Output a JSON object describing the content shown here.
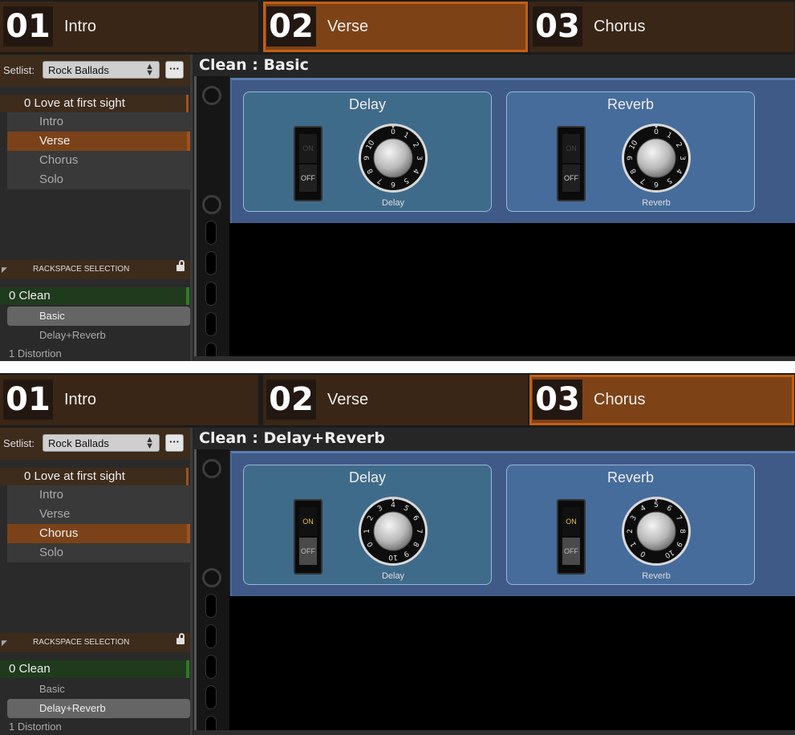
{
  "panels": [
    {
      "parts": [
        {
          "num": "01",
          "name": "Intro"
        },
        {
          "num": "02",
          "name": "Verse"
        },
        {
          "num": "03",
          "name": "Chorus"
        }
      ],
      "active_part": 1,
      "setlist_label": "Setlist:",
      "setlist_value": "Rock Ballads",
      "more_label": "···",
      "song": "0  Love at first sight",
      "song_parts": [
        "Intro",
        "Verse",
        "Chorus",
        "Solo"
      ],
      "active_song_part": 1,
      "rackspace_header": "RACKSPACE SELECTION",
      "rackspace": "0  Clean",
      "variations": [
        "Basic",
        "Delay+Reverb"
      ],
      "active_variation": 0,
      "rackspace_next": "1  Distortion",
      "title": "Clean : Basic",
      "delay": {
        "title": "Delay",
        "switch_on": "ON",
        "switch_off": "OFF",
        "switch_state": "off",
        "knob_label": "Delay",
        "knob_value": 0,
        "knob_ticks": [
          "0",
          "1",
          "2",
          "3",
          "4",
          "5",
          "6",
          "7",
          "8",
          "9",
          "10"
        ]
      },
      "reverb": {
        "title": "Reverb",
        "switch_on": "ON",
        "switch_off": "OFF",
        "switch_state": "off",
        "knob_label": "Reverb",
        "knob_value": 0,
        "knob_ticks": [
          "0",
          "1",
          "2",
          "3",
          "4",
          "5",
          "6",
          "7",
          "8",
          "9",
          "10"
        ]
      }
    },
    {
      "parts": [
        {
          "num": "01",
          "name": "Intro"
        },
        {
          "num": "02",
          "name": "Verse"
        },
        {
          "num": "03",
          "name": "Chorus"
        }
      ],
      "active_part": 2,
      "setlist_label": "Setlist:",
      "setlist_value": "Rock Ballads",
      "more_label": "···",
      "song": "0  Love at first sight",
      "song_parts": [
        "Intro",
        "Verse",
        "Chorus",
        "Solo"
      ],
      "active_song_part": 2,
      "rackspace_header": "RACKSPACE SELECTION",
      "rackspace": "0  Clean",
      "variations": [
        "Basic",
        "Delay+Reverb"
      ],
      "active_variation": 1,
      "rackspace_next": "1  Distortion",
      "title": "Clean : Delay+Reverb",
      "delay": {
        "title": "Delay",
        "switch_on": "ON",
        "switch_off": "OFF",
        "switch_state": "on",
        "knob_label": "Delay",
        "knob_value": 4,
        "knob_ticks": [
          "0",
          "1",
          "2",
          "3",
          "4",
          "5",
          "6",
          "7",
          "8",
          "9",
          "10"
        ]
      },
      "reverb": {
        "title": "Reverb",
        "switch_on": "ON",
        "switch_off": "OFF",
        "switch_state": "on",
        "knob_label": "Reverb",
        "knob_value": 5,
        "knob_ticks": [
          "0",
          "1",
          "2",
          "3",
          "4",
          "5",
          "6",
          "7",
          "8",
          "9",
          "10"
        ]
      }
    }
  ],
  "colors": {
    "active_part": "#7d4317",
    "active_border": "#c45e14",
    "rackspace_green": "#1f3a1d",
    "plugin_blue": "#3f5a86"
  }
}
